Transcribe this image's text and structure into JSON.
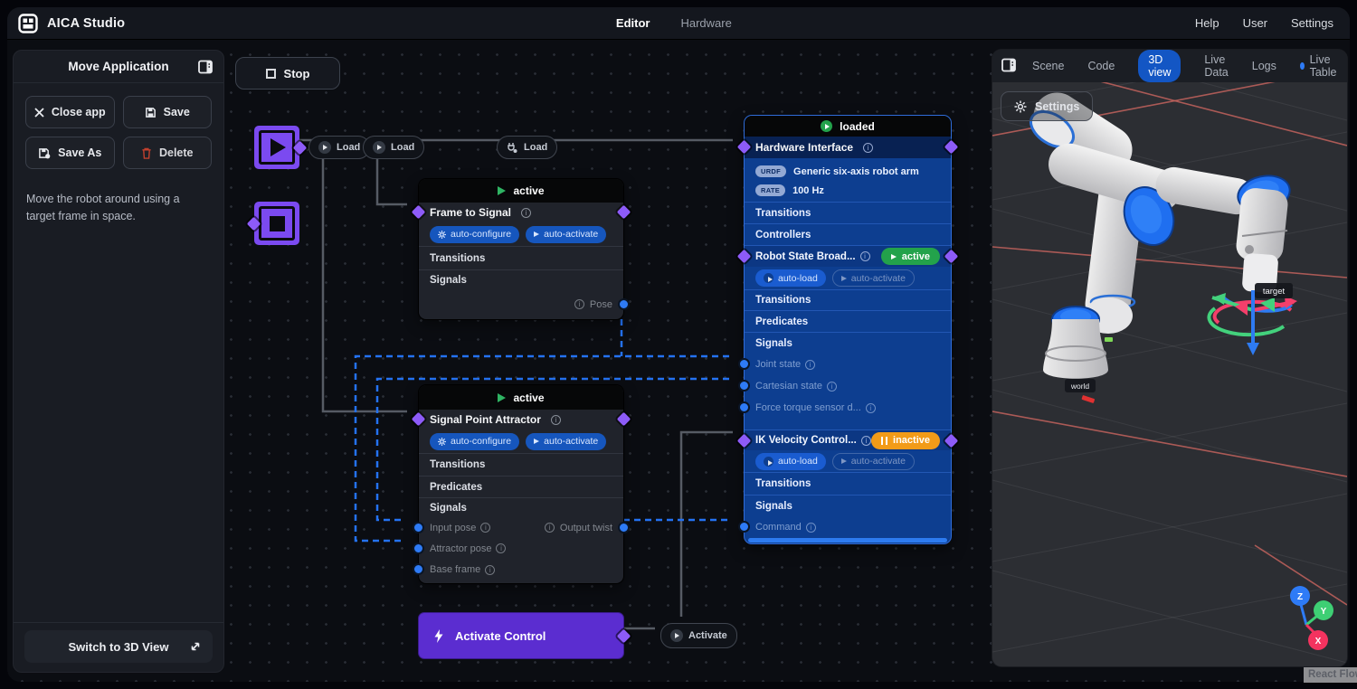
{
  "titlebar": {
    "app_title": "AICA Studio",
    "tab_editor": "Editor",
    "tab_hardware": "Hardware",
    "help": "Help",
    "user": "User",
    "settings": "Settings"
  },
  "sidebar": {
    "title": "Move Application",
    "close_app": "Close app",
    "save": "Save",
    "save_as": "Save As",
    "delete": "Delete",
    "description": "Move the robot around using a target frame in space.",
    "switch_3d": "Switch to 3D View"
  },
  "canvas": {
    "stop_button": "Stop",
    "load_pill_1": "Load",
    "load_pill_2": "Load",
    "load_pill_3": "Load",
    "activate_pill": "Activate",
    "frame_to_signal": {
      "status": "active",
      "title": "Frame to Signal",
      "pill_configure": "auto-configure",
      "pill_activate": "auto-activate",
      "section_transitions": "Transitions",
      "section_signals": "Signals",
      "port_pose": "Pose"
    },
    "attractor": {
      "status": "active",
      "title": "Signal Point Attractor",
      "pill_configure": "auto-configure",
      "pill_activate": "auto-activate",
      "section_transitions": "Transitions",
      "section_predicates": "Predicates",
      "section_signals": "Signals",
      "port_input_pose": "Input pose",
      "port_output_twist": "Output twist",
      "port_attractor_pose": "Attractor pose",
      "port_base_frame": "Base frame"
    },
    "hardware": {
      "status": "loaded",
      "title": "Hardware Interface",
      "urdf_badge": "URDF",
      "urdf_value": "Generic six-axis robot arm",
      "rate_badge": "RATE",
      "rate_value": "100 Hz",
      "section_transitions": "Transitions",
      "section_controllers": "Controllers",
      "rsb": {
        "title": "Robot State Broad...",
        "status": "active",
        "pill_load": "auto-load",
        "pill_activate": "auto-activate",
        "section_transitions": "Transitions",
        "section_predicates": "Predicates",
        "section_signals": "Signals",
        "port_joint": "Joint state",
        "port_cartesian": "Cartesian state",
        "port_force": "Force torque sensor d..."
      },
      "ik": {
        "title": "IK Velocity Control...",
        "status": "inactive",
        "pill_load": "auto-load",
        "pill_activate": "auto-activate",
        "section_transitions": "Transitions",
        "section_signals": "Signals",
        "port_command": "Command"
      }
    },
    "activate_control": {
      "label": "Activate Control"
    }
  },
  "right_panel": {
    "tab_scene": "Scene",
    "tab_code": "Code",
    "tab_3d": "3D view",
    "tab_live_data": "Live Data",
    "tab_logs": "Logs",
    "tab_live_table": "Live Table",
    "settings_button": "Settings",
    "target_label": "target",
    "world_label": "world",
    "axis_x": "X",
    "axis_y": "Y",
    "axis_z": "Z",
    "watermark": "React Flow"
  },
  "colors": {
    "accent_purple": "#8d5bf8",
    "node_blue": "#0d3e90",
    "status_green": "#23a24b",
    "status_orange": "#f29b18",
    "port_blue": "#2e7bf6",
    "tab_active_blue": "#1356c4"
  }
}
